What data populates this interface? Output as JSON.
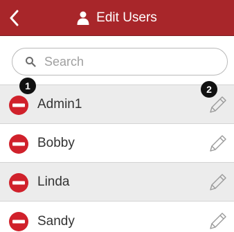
{
  "header": {
    "title": "Edit Users"
  },
  "search": {
    "placeholder": "Search"
  },
  "users": [
    {
      "name": "Admin1"
    },
    {
      "name": "Bobby"
    },
    {
      "name": "Linda"
    },
    {
      "name": "Sandy"
    }
  ],
  "callouts": {
    "first": "1",
    "second": "2"
  },
  "colors": {
    "header": "#a8262a",
    "delete": "#d0212b",
    "row_shaded": "#ececec"
  }
}
